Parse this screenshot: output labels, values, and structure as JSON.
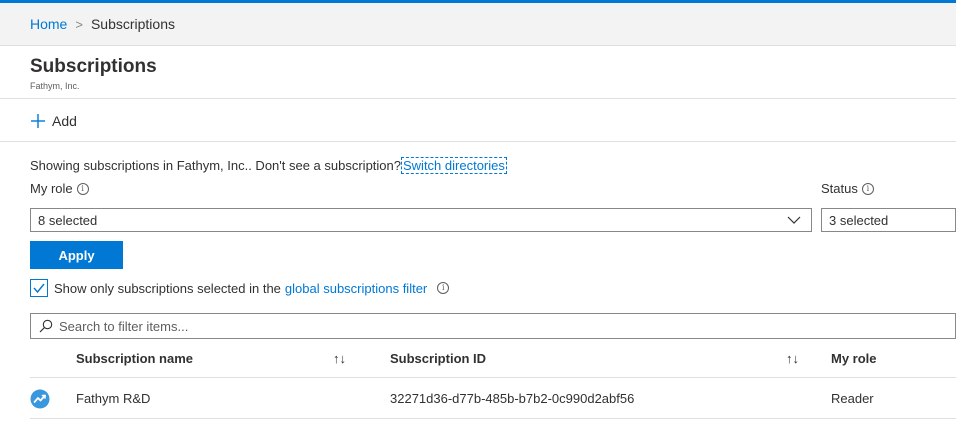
{
  "breadcrumb": {
    "home": "Home",
    "separator": ">",
    "current": "Subscriptions"
  },
  "header": {
    "title": "Subscriptions",
    "subtitle": "Fathym, Inc."
  },
  "command_bar": {
    "add_label": "Add"
  },
  "info": {
    "text": "Showing subscriptions in Fathym, Inc.. Don't see a subscription?",
    "link": "Switch directories"
  },
  "filters": {
    "my_role_label": "My role",
    "my_role_value": "8 selected",
    "status_label": "Status",
    "status_value": "3 selected",
    "info_glyph": "i"
  },
  "apply_label": "Apply",
  "global_filter": {
    "checked": true,
    "text_before": "Show only subscriptions selected in the",
    "link": "global subscriptions filter"
  },
  "search": {
    "placeholder": "Search to filter items..."
  },
  "table": {
    "columns": [
      "Subscription name",
      "Subscription ID",
      "My role"
    ],
    "sort_glyph": "↑↓",
    "rows": [
      {
        "name": "Fathym R&D",
        "id": "32271d36-d77b-485b-b7b2-0c990d2abf56",
        "role": "Reader"
      }
    ]
  },
  "colors": {
    "accent": "#0078d4",
    "border": "#8a8886",
    "divider": "#e1dfdd"
  }
}
